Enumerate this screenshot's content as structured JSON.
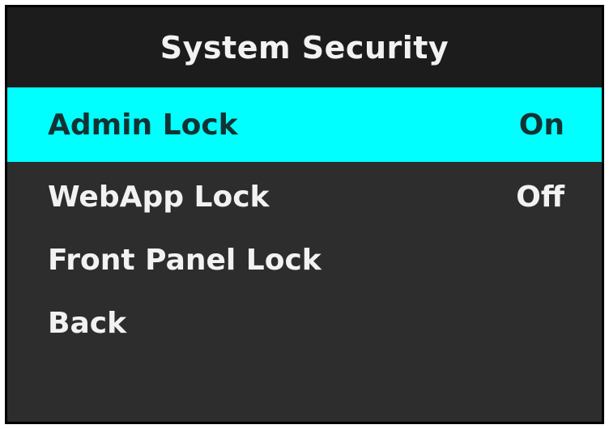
{
  "title": "System Security",
  "colors": {
    "background": "#2d2d2d",
    "title_background": "#1c1c1c",
    "selection": "#00ffff",
    "text": "#f2f2f2",
    "selected_text": "#123333"
  },
  "menu": {
    "selected_index": 0,
    "items": [
      {
        "label": "Admin Lock",
        "value": "On"
      },
      {
        "label": "WebApp Lock",
        "value": "Off"
      },
      {
        "label": "Front Panel Lock",
        "value": ""
      },
      {
        "label": "Back",
        "value": ""
      }
    ]
  }
}
